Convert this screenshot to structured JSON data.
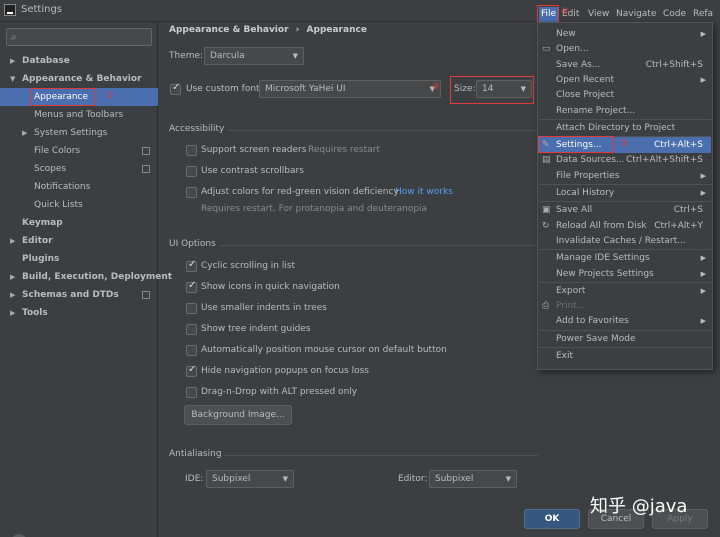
{
  "window": {
    "title": "Settings"
  },
  "sidebar": {
    "search_placeholder": "",
    "items": [
      {
        "label": "Database",
        "expanded": false,
        "bold": true,
        "level": 0
      },
      {
        "label": "Appearance & Behavior",
        "expanded": true,
        "bold": true,
        "level": 0
      },
      {
        "label": "Appearance",
        "level": 1,
        "selected": true
      },
      {
        "label": "Menus and Toolbars",
        "level": 1
      },
      {
        "label": "System Settings",
        "level": 1,
        "expanded": false
      },
      {
        "label": "File Colors",
        "level": 1
      },
      {
        "label": "Scopes",
        "level": 1
      },
      {
        "label": "Notifications",
        "level": 1
      },
      {
        "label": "Quick Lists",
        "level": 1
      },
      {
        "label": "Keymap",
        "bold": true,
        "level": 0
      },
      {
        "label": "Editor",
        "bold": true,
        "level": 0,
        "expanded": false
      },
      {
        "label": "Plugins",
        "bold": true,
        "level": 0
      },
      {
        "label": "Build, Execution, Deployment",
        "bold": true,
        "level": 0,
        "expanded": false
      },
      {
        "label": "Schemas and DTDs",
        "bold": true,
        "level": 0,
        "expanded": false
      },
      {
        "label": "Tools",
        "bold": true,
        "level": 0,
        "expanded": false
      }
    ],
    "annotation_1": "①"
  },
  "content": {
    "breadcrumb": [
      "Appearance & Behavior",
      "›",
      "Appearance"
    ],
    "theme_label": "Theme:",
    "theme_value": "Darcula",
    "custom_font_label": "Use custom font:",
    "custom_font_checked": true,
    "font_value": "Microsoft YaHei UI",
    "size_label": "Size:",
    "size_value": "14",
    "annotation_4": "④",
    "accessibility": {
      "title": "Accessibility",
      "screen_readers": "Support screen readers",
      "requires_restart": "Requires restart",
      "contrast_scrollbars": "Use contrast scrollbars",
      "adjust_colors": "Adjust colors for red-green vision deficiency",
      "how_it_works": "How it works",
      "protanopia_note": "Requires restart. For protanopia and deuteranopia"
    },
    "ui_options": {
      "title": "UI Options",
      "items": [
        {
          "label": "Cyclic scrolling in list",
          "checked": true
        },
        {
          "label": "Show icons in quick navigation",
          "checked": true
        },
        {
          "label": "Use smaller indents in trees",
          "checked": false
        },
        {
          "label": "Show tree indent guides",
          "checked": false
        },
        {
          "label": "Automatically position mouse cursor on default button",
          "checked": false
        },
        {
          "label": "Hide navigation popups on focus loss",
          "checked": true
        },
        {
          "label": "Drag-n-Drop with ALT pressed only",
          "checked": false
        }
      ],
      "background_image_button": "Background Image..."
    },
    "antialiasing": {
      "title": "Antialiasing",
      "ide_label": "IDE:",
      "ide_value": "Subpixel",
      "editor_label": "Editor:",
      "editor_value": "Subpixel"
    }
  },
  "footer": {
    "help": "?",
    "ok": "OK",
    "cancel": "Cancel",
    "apply": "Apply"
  },
  "menubar": {
    "items": [
      "File",
      "Edit",
      "View",
      "Navigate",
      "Code",
      "Refa"
    ]
  },
  "file_menu": {
    "annotation_2": "②",
    "items": [
      {
        "label": "New",
        "submenu": true
      },
      {
        "label": "Open...",
        "icon": "folder-icon"
      },
      {
        "label": "Save As...",
        "shortcut": "Ctrl+Shift+S"
      },
      {
        "label": "Open Recent",
        "submenu": true
      },
      {
        "label": "Close Project"
      },
      {
        "label": "Rename Project..."
      },
      {
        "sep": true
      },
      {
        "label": "Attach Directory to Project"
      },
      {
        "sep": true
      },
      {
        "label": "Settings...",
        "shortcut": "Ctrl+Alt+S",
        "icon": "wrench-icon",
        "highlight": true
      },
      {
        "label": "Data Sources...",
        "shortcut": "Ctrl+Alt+Shift+S",
        "icon": "database-icon"
      },
      {
        "label": "File Properties",
        "submenu": true
      },
      {
        "sep": true
      },
      {
        "label": "Local History",
        "submenu": true
      },
      {
        "sep": true
      },
      {
        "label": "Save All",
        "shortcut": "Ctrl+S",
        "icon": "save-icon"
      },
      {
        "label": "Reload All from Disk",
        "shortcut": "Ctrl+Alt+Y",
        "icon": "reload-icon"
      },
      {
        "label": "Invalidate Caches / Restart..."
      },
      {
        "sep": true
      },
      {
        "label": "Manage IDE Settings",
        "submenu": true
      },
      {
        "label": "New Projects Settings",
        "submenu": true
      },
      {
        "sep": true
      },
      {
        "label": "Export",
        "submenu": true
      },
      {
        "label": "Print...",
        "disabled": true,
        "icon": "print-icon"
      },
      {
        "label": "Add to Favorites",
        "submenu": true
      },
      {
        "sep": true
      },
      {
        "label": "Power Save Mode"
      },
      {
        "sep": true
      },
      {
        "label": "Exit"
      }
    ],
    "annotation_3": "③"
  },
  "watermark": "知乎 @java"
}
